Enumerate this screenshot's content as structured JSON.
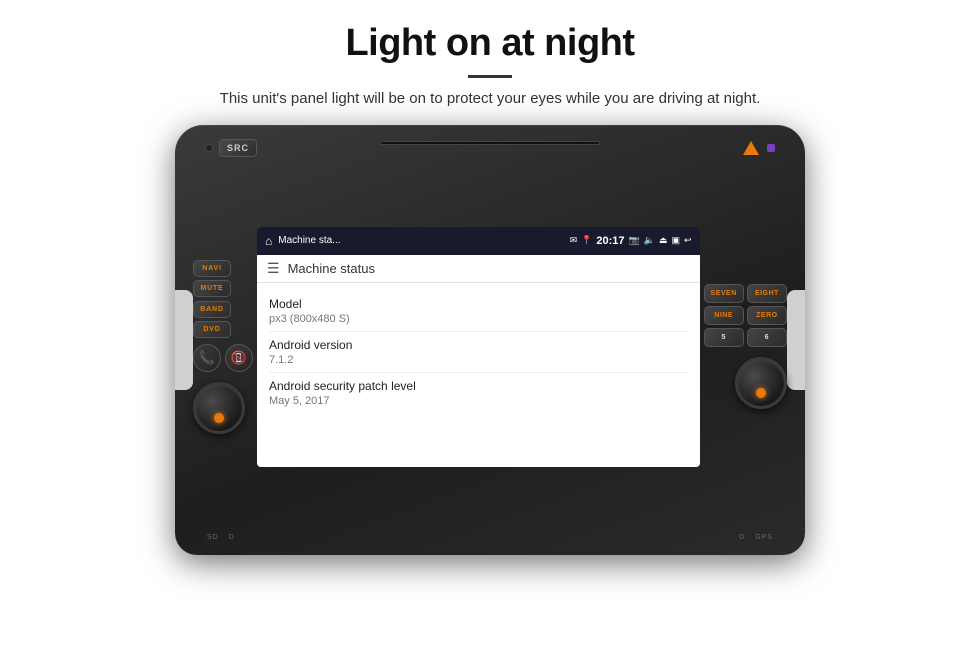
{
  "page": {
    "title": "Light on at night",
    "divider": "",
    "subtitle": "This unit's panel light will be on to protect your eyes while you are driving at night."
  },
  "head_unit": {
    "src_button": "SRC",
    "buttons_left": {
      "row1": [
        "NAVI",
        "MUTE"
      ],
      "row2": [
        "BAND",
        "DVD"
      ]
    },
    "buttons_right": {
      "row1": [
        "SEVEN",
        "EIGHT"
      ],
      "row2": [
        "NINE",
        "ZERO"
      ],
      "row3": [
        "5",
        "6"
      ]
    }
  },
  "android": {
    "status_bar": {
      "app_name": "Machine sta...",
      "time": "20:17"
    },
    "app_header": {
      "title": "Machine status"
    },
    "info_items": [
      {
        "label": "Model",
        "value": "px3 (800x480 S)"
      },
      {
        "label": "Android version",
        "value": "7.1.2"
      },
      {
        "label": "Android security patch level",
        "value": "May 5, 2017"
      }
    ]
  },
  "bottom_labels": {
    "left": [
      "SD",
      "D"
    ],
    "right": [
      "D",
      "GPS"
    ]
  }
}
